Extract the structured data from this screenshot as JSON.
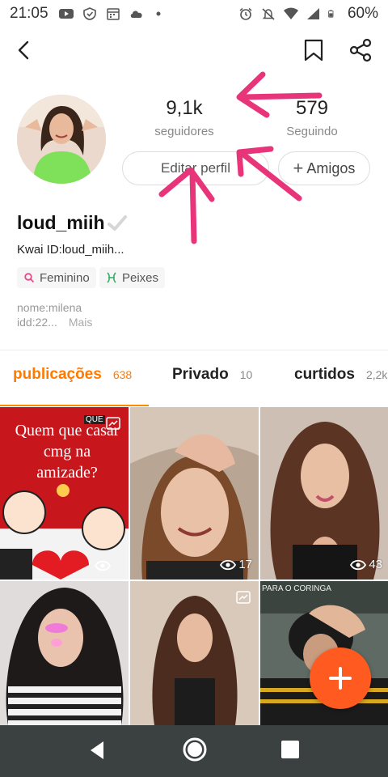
{
  "status_bar": {
    "time": "21:05",
    "battery": "60%"
  },
  "profile": {
    "followers_count": "9,1k",
    "followers_label": "seguidores",
    "following_count": "579",
    "following_label": "Seguindo",
    "edit_label": "Editar perfil",
    "friends_label": "Amigos",
    "username": "loud_miih",
    "kwai_id": "Kwai ID:loud_miih...",
    "gender_tag": "Feminino",
    "zodiac_tag": "Peixes",
    "bio_line1": "nome:milena",
    "bio_line2": "idd:22...",
    "more_label": "Mais"
  },
  "tabs": [
    {
      "label": "publicações",
      "count": "638"
    },
    {
      "label": "Privado",
      "count": "10"
    },
    {
      "label": "curtidos",
      "count": "2,2k"
    }
  ],
  "posts": [
    {
      "caption": "Quem que casar cmg na amizade?",
      "corner_tag": "QUE"
    },
    {
      "views": "17"
    },
    {
      "views": "43"
    },
    {},
    {},
    {
      "caption": "PARA O CORINGA"
    }
  ],
  "colors": {
    "accent": "#ff7a00",
    "fab": "#ff5a1f",
    "annotation": "#e8357a"
  }
}
